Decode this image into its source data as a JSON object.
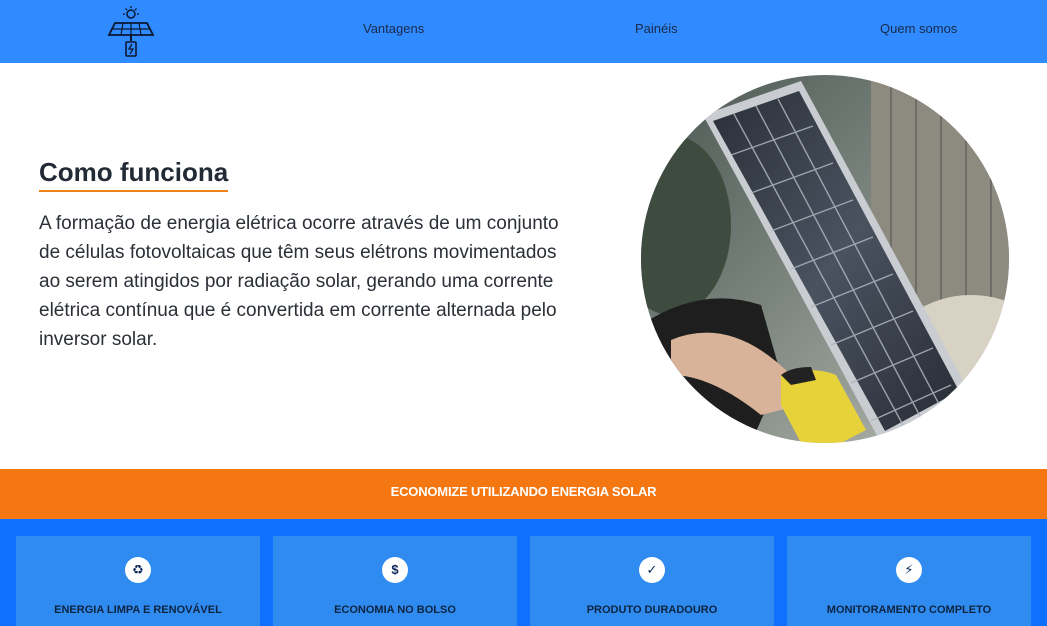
{
  "nav": {
    "items": [
      {
        "label": "Vantagens"
      },
      {
        "label": "Painéis"
      },
      {
        "label": "Quem somos"
      }
    ]
  },
  "hero": {
    "title": "Como funciona",
    "text": "A formação de energia elétrica ocorre através de um conjunto de células fotovoltaicas que têm seus elétrons movimentados ao serem atingidos por radiação solar, gerando uma corrente elétrica contínua que é convertida em corrente alternada pelo inversor solar."
  },
  "band": {
    "text": "ECONOMIZE UTILIZANDO ENERGIA SOLAR"
  },
  "features": [
    {
      "icon": "recycle-icon",
      "glyph": "♻",
      "label": "ENERGIA LIMPA E RENOVÁVEL"
    },
    {
      "icon": "dollar-icon",
      "glyph": "$",
      "label": "ECONOMIA NO BOLSO"
    },
    {
      "icon": "check-icon",
      "glyph": "✓",
      "label": "PRODUTO DURADOURO"
    },
    {
      "icon": "bolt-icon",
      "glyph": "⚡",
      "label": "MONITORAMENTO COMPLETO"
    }
  ],
  "colors": {
    "header": "#2f8bff",
    "accent": "#f47712",
    "features_bg": "#0f6fff",
    "card_bg": "#2f8bf0"
  }
}
